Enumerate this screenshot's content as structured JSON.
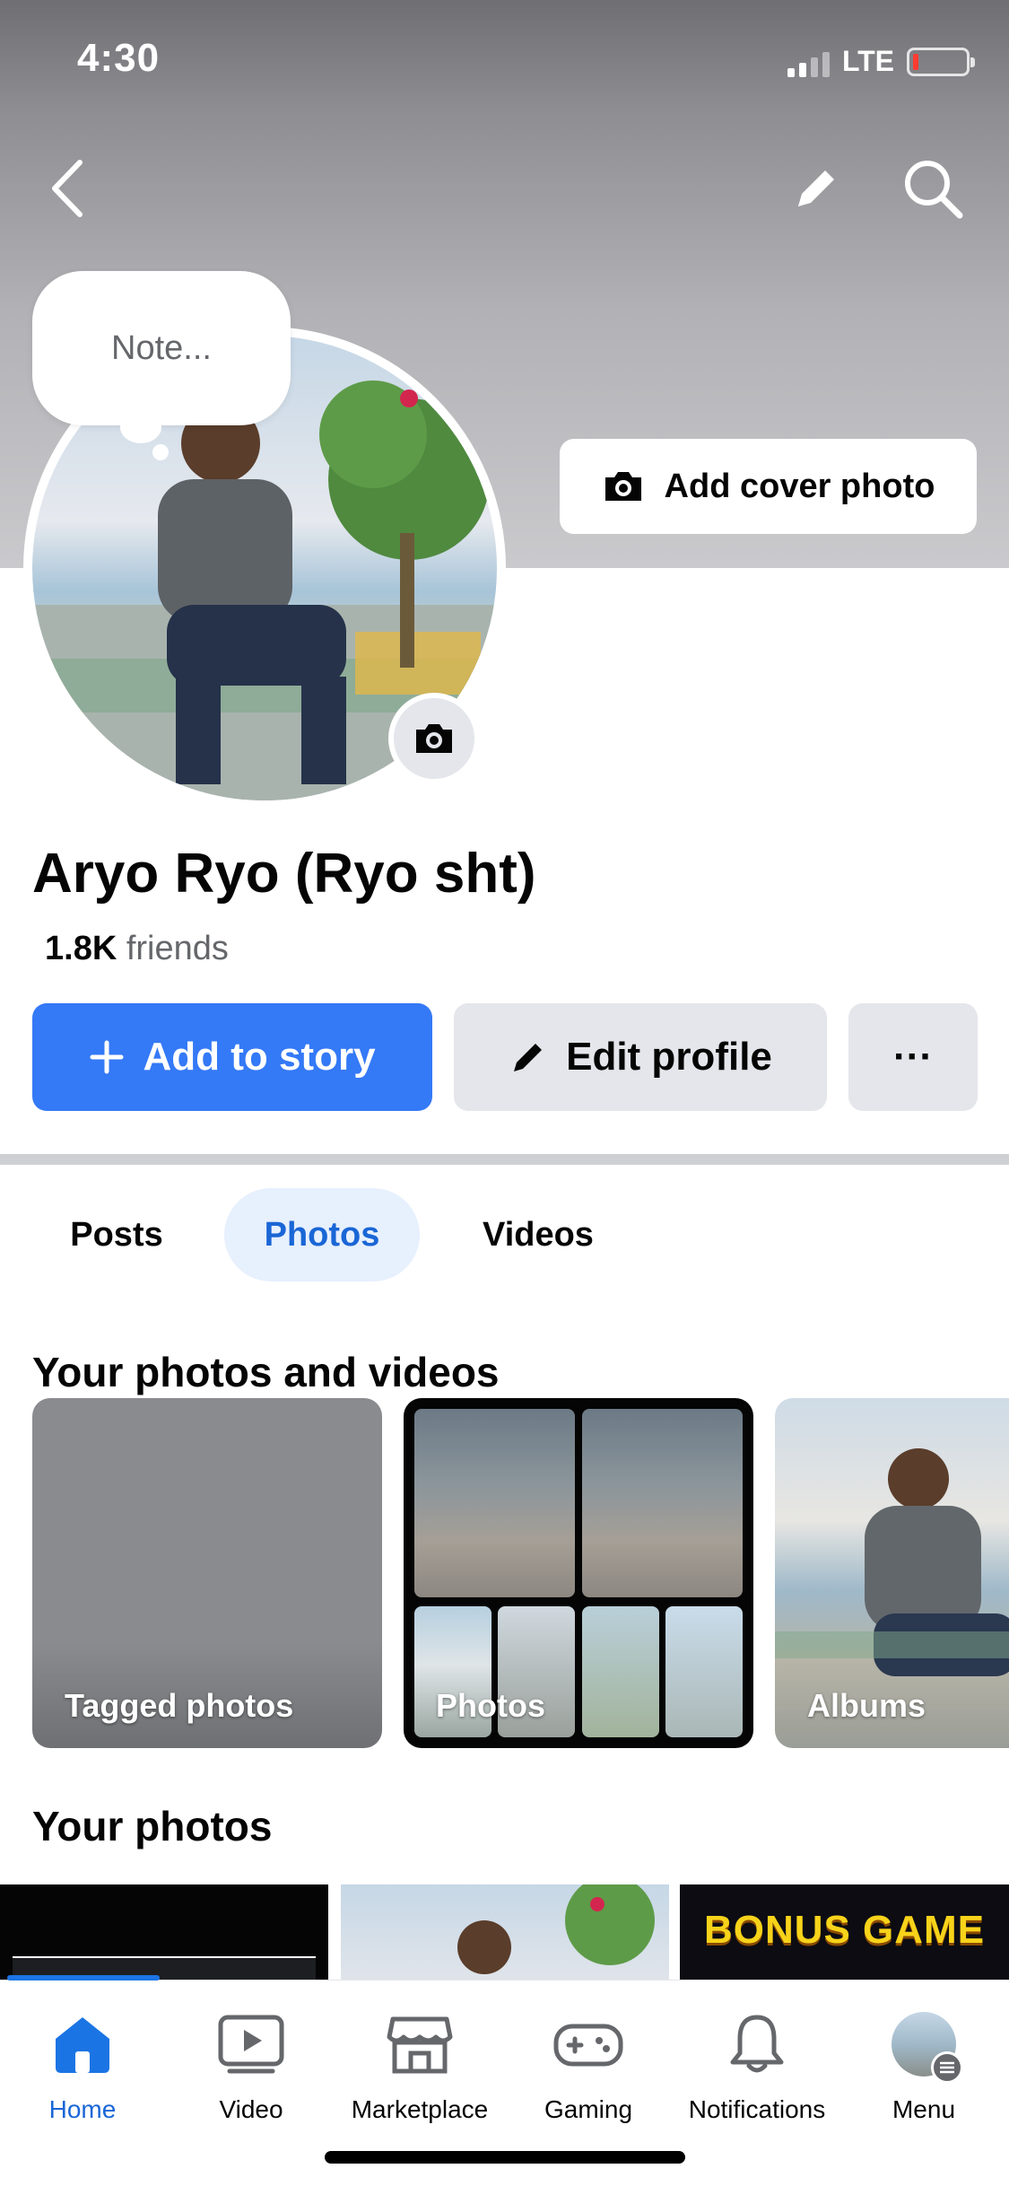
{
  "status_bar": {
    "time": "4:30",
    "network": "LTE"
  },
  "note": {
    "placeholder": "Note..."
  },
  "cover": {
    "add_cover_label": "Add cover photo"
  },
  "profile": {
    "name": "Aryo Ryo (Ryo sht)",
    "friends_count": "1.8K",
    "friends_label": "friends"
  },
  "actions": {
    "add_story": "Add to story",
    "edit_profile": "Edit profile",
    "more": "···"
  },
  "tabs": [
    {
      "label": "Posts",
      "active": false
    },
    {
      "label": "Photos",
      "active": true
    },
    {
      "label": "Videos",
      "active": false
    }
  ],
  "sections": {
    "photos_and_videos": "Your photos and videos",
    "your_photos": "Your photos"
  },
  "tiles": [
    {
      "label": "Tagged photos"
    },
    {
      "label": "Photos"
    },
    {
      "label": "Albums"
    }
  ],
  "photo_strip": {
    "third_text": "BONUS GAME"
  },
  "bottom_nav": [
    {
      "label": "Home",
      "icon": "home-icon",
      "active": true
    },
    {
      "label": "Video",
      "icon": "video-icon",
      "active": false
    },
    {
      "label": "Marketplace",
      "icon": "marketplace-icon",
      "active": false
    },
    {
      "label": "Gaming",
      "icon": "gaming-icon",
      "active": false
    },
    {
      "label": "Notifications",
      "icon": "bell-icon",
      "active": false
    },
    {
      "label": "Menu",
      "icon": "menu-avatar",
      "active": false
    }
  ],
  "colors": {
    "accent": "#3479f6",
    "active_tab_text": "#1a66d6",
    "active_tab_bg": "#e7f0fd",
    "button_gray": "#e4e6eb"
  }
}
